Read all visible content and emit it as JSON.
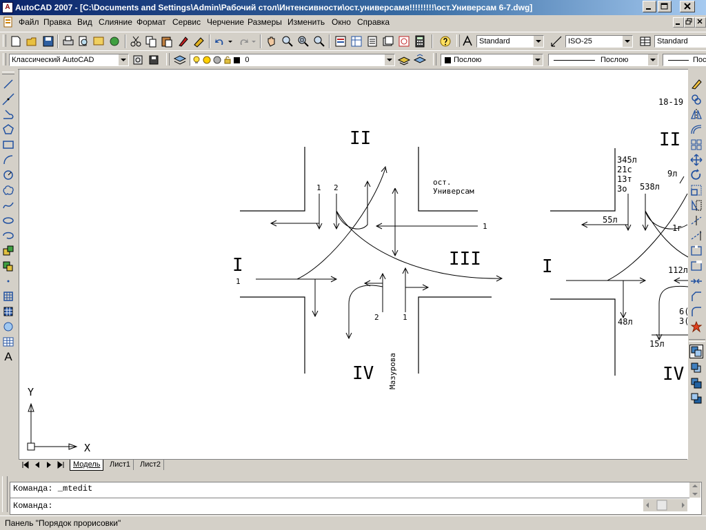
{
  "window": {
    "title": "AutoCAD 2007 - [C:\\Documents and Settings\\Admin\\Рабочий стол\\Интенсивности\\ост.универсамя!!!!!!!!!\\ост.Универсам 6-7.dwg]",
    "app_icon_text": "A"
  },
  "menu": [
    "Файл",
    "Правка",
    "Вид",
    "Слияние",
    "Формат",
    "Сервис",
    "Черчение",
    "Размеры",
    "Изменить",
    "Окно",
    "Справка"
  ],
  "styles_toolbar": {
    "text_style": "Standard",
    "dim_style": "ISO-25",
    "table_style": "Standard"
  },
  "workspace": {
    "name": "Классический AutoCAD"
  },
  "layers": {
    "current": "0"
  },
  "properties": {
    "color": "Послою",
    "linetype": "Послою",
    "lineweight": "Пос"
  },
  "drawing": {
    "left": {
      "sector_labels": [
        "II",
        "I",
        "III",
        "IV"
      ],
      "lane_labels": [
        "1",
        "2",
        "1",
        "1",
        "2",
        "1"
      ],
      "stop_label_line1": "ост.",
      "stop_label_line2": "Универсам",
      "street_label": "Мазурова"
    },
    "right": {
      "header": "18-19",
      "sector_labels": [
        "II",
        "I",
        "IV"
      ],
      "volumes": [
        "345л",
        "21с",
        "13т",
        "3о",
        "9л",
        "538л",
        "55л",
        "1г",
        "112л",
        "48л",
        "15л",
        "6(",
        "3("
      ]
    },
    "ucs": {
      "x": "X",
      "y": "Y"
    }
  },
  "tabs": [
    "Модель",
    "Лист1",
    "Лист2"
  ],
  "command": {
    "history": "Команда:  _mtedit",
    "prompt": "Команда:"
  },
  "status": {
    "text": "Панель \"Порядок прорисовки\""
  },
  "colors": {
    "titlebar_start": "#0a246a",
    "titlebar_end": "#a6caf0",
    "chrome": "#d4d0c8",
    "canvas": "#ffffff"
  }
}
